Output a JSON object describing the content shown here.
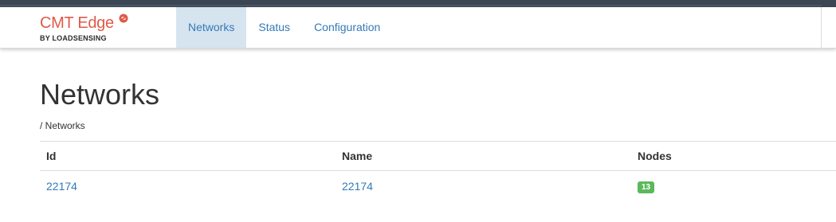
{
  "brand": {
    "title": "CMT Edge",
    "subtitle": "BY LOADSENSING",
    "logo_icon": "brand-swirl-icon",
    "brand_color": "#e05a48"
  },
  "nav": {
    "items": [
      {
        "label": "Networks",
        "active": true
      },
      {
        "label": "Status",
        "active": false
      },
      {
        "label": "Configuration",
        "active": false
      }
    ],
    "link_color": "#337ab7",
    "active_bg": "#d6e4f0"
  },
  "page": {
    "title": "Networks",
    "breadcrumb": "/ Networks"
  },
  "table": {
    "headers": [
      "Id",
      "Name",
      "Nodes"
    ],
    "rows": [
      {
        "id": "22174",
        "name": "22174",
        "nodes": "13"
      }
    ],
    "badge_color": "#5cb85c"
  }
}
